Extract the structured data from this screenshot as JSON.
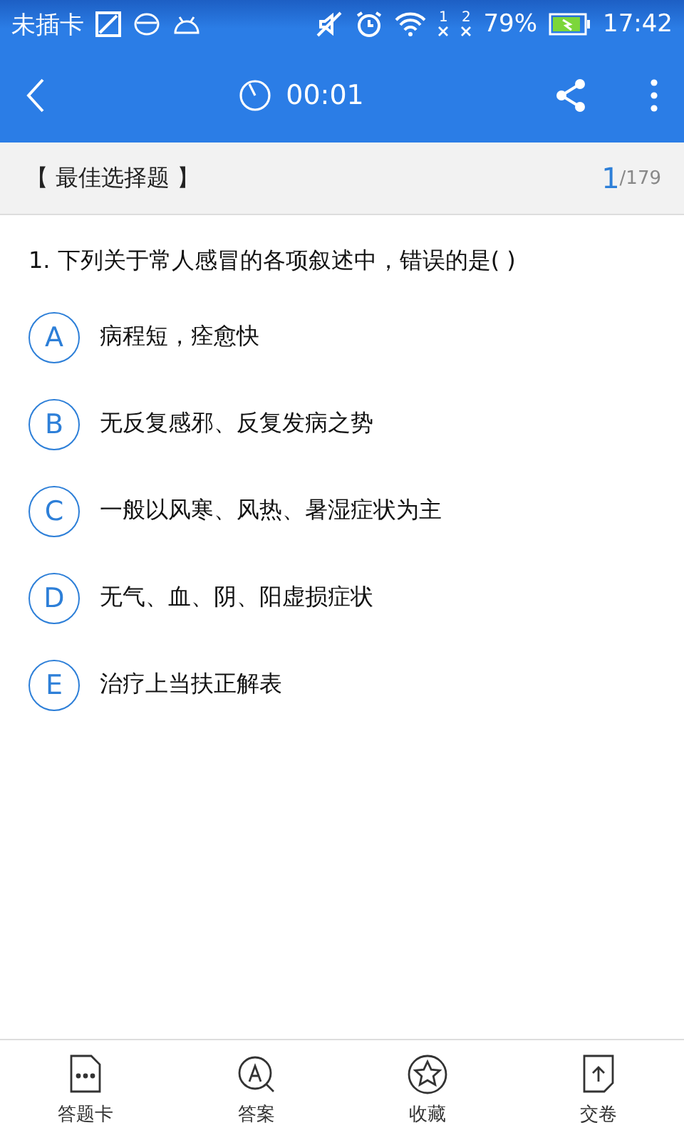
{
  "status_bar": {
    "carrier": "未插卡",
    "sim_slots": [
      "1",
      "2"
    ],
    "battery_percent": "79%",
    "time": "17:42"
  },
  "app_bar": {
    "timer": "00:01"
  },
  "section": {
    "title": "【 最佳选择题 】",
    "current": "1",
    "total": "/179"
  },
  "question": {
    "text": "1. 下列关于常人感冒的各项叙述中，错误的是(   )"
  },
  "options": [
    {
      "letter": "A",
      "text": "病程短，痊愈快",
      "selected": false
    },
    {
      "letter": "B",
      "text": "无反复感邪、反复发病之势",
      "selected": false
    },
    {
      "letter": "C",
      "text": "一般以风寒、风热、暑湿症状为主",
      "selected": false
    },
    {
      "letter": "D",
      "text": "无气、血、阴、阳虚损症状",
      "selected": false
    },
    {
      "letter": "E",
      "text": "治疗上当扶正解表",
      "selected": false
    }
  ],
  "bottom_nav": [
    {
      "kind": "card",
      "label": "答题卡"
    },
    {
      "kind": "answer",
      "label": "答案"
    },
    {
      "kind": "favorite",
      "label": "收藏"
    },
    {
      "kind": "submit",
      "label": "交卷"
    }
  ]
}
